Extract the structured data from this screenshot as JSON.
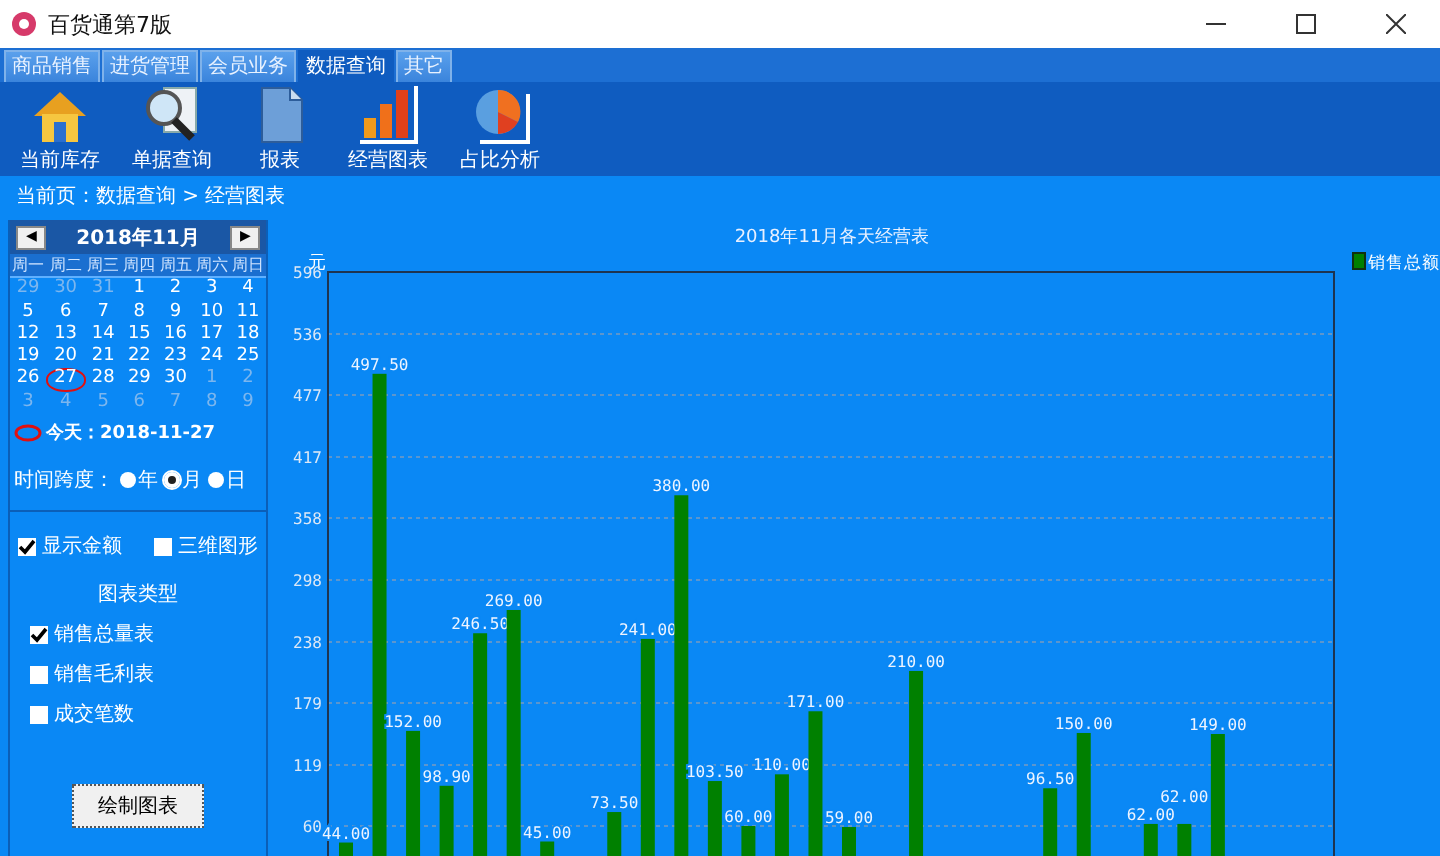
{
  "window": {
    "title": "百货通第7版"
  },
  "tabs": [
    {
      "label": "商品销售",
      "selected": false
    },
    {
      "label": "进货管理",
      "selected": false
    },
    {
      "label": "会员业务",
      "selected": false
    },
    {
      "label": "数据查询",
      "selected": true
    },
    {
      "label": "其它",
      "selected": false
    }
  ],
  "toolbar": [
    {
      "kind": "house",
      "label": "当前库存"
    },
    {
      "kind": "search",
      "label": "单据查询"
    },
    {
      "kind": "document",
      "label": "报表"
    },
    {
      "kind": "bars",
      "label": "经营图表"
    },
    {
      "kind": "pie",
      "label": "占比分析"
    }
  ],
  "breadcrumb": "当前页：数据查询 > 经营图表",
  "calendar": {
    "prev": "◀",
    "title": "2018年11月",
    "next": "▶",
    "weekdays": [
      "周一",
      "周二",
      "周三",
      "周四",
      "周五",
      "周六",
      "周日"
    ],
    "days": [
      {
        "day": "29",
        "muted": true,
        "selected": false
      },
      {
        "day": "30",
        "muted": true,
        "selected": false
      },
      {
        "day": "31",
        "muted": true,
        "selected": false
      },
      {
        "day": "1",
        "muted": false,
        "selected": false
      },
      {
        "day": "2",
        "muted": false,
        "selected": false
      },
      {
        "day": "3",
        "muted": false,
        "selected": false
      },
      {
        "day": "4",
        "muted": false,
        "selected": false
      },
      {
        "day": "5",
        "muted": false,
        "selected": false
      },
      {
        "day": "6",
        "muted": false,
        "selected": false
      },
      {
        "day": "7",
        "muted": false,
        "selected": false
      },
      {
        "day": "8",
        "muted": false,
        "selected": false
      },
      {
        "day": "9",
        "muted": false,
        "selected": false
      },
      {
        "day": "10",
        "muted": false,
        "selected": false
      },
      {
        "day": "11",
        "muted": false,
        "selected": false
      },
      {
        "day": "12",
        "muted": false,
        "selected": false
      },
      {
        "day": "13",
        "muted": false,
        "selected": false
      },
      {
        "day": "14",
        "muted": false,
        "selected": false
      },
      {
        "day": "15",
        "muted": false,
        "selected": false
      },
      {
        "day": "16",
        "muted": false,
        "selected": false
      },
      {
        "day": "17",
        "muted": false,
        "selected": false
      },
      {
        "day": "18",
        "muted": false,
        "selected": false
      },
      {
        "day": "19",
        "muted": false,
        "selected": false
      },
      {
        "day": "20",
        "muted": false,
        "selected": false
      },
      {
        "day": "21",
        "muted": false,
        "selected": false
      },
      {
        "day": "22",
        "muted": false,
        "selected": false
      },
      {
        "day": "23",
        "muted": false,
        "selected": false
      },
      {
        "day": "24",
        "muted": false,
        "selected": false
      },
      {
        "day": "25",
        "muted": false,
        "selected": false
      },
      {
        "day": "26",
        "muted": false,
        "selected": false
      },
      {
        "day": "27",
        "muted": false,
        "selected": true
      },
      {
        "day": "28",
        "muted": false,
        "selected": false
      },
      {
        "day": "29",
        "muted": false,
        "selected": false
      },
      {
        "day": "30",
        "muted": false,
        "selected": false
      },
      {
        "day": "1",
        "muted": true,
        "selected": false
      },
      {
        "day": "2",
        "muted": true,
        "selected": false
      },
      {
        "day": "3",
        "muted": true,
        "selected": false
      },
      {
        "day": "4",
        "muted": true,
        "selected": false
      },
      {
        "day": "5",
        "muted": true,
        "selected": false
      },
      {
        "day": "6",
        "muted": true,
        "selected": false
      },
      {
        "day": "7",
        "muted": true,
        "selected": false
      },
      {
        "day": "8",
        "muted": true,
        "selected": false
      },
      {
        "day": "9",
        "muted": true,
        "selected": false
      }
    ],
    "today": "今天：2018-11-27"
  },
  "span": {
    "label": "时间跨度：",
    "options": [
      {
        "label": "年",
        "selected": false
      },
      {
        "label": "月",
        "selected": true
      },
      {
        "label": "日",
        "selected": false
      }
    ]
  },
  "options": [
    {
      "label": "显示金额",
      "checked": true
    },
    {
      "label": "三维图形",
      "checked": false
    }
  ],
  "chart_types": {
    "title": "图表类型",
    "items": [
      {
        "label": "销售总量表",
        "checked": true
      },
      {
        "label": "销售毛利表",
        "checked": false
      },
      {
        "label": "成交笔数",
        "checked": false
      }
    ]
  },
  "draw_button": "绘制图表",
  "chart": {
    "chart_data": {
      "type": "bar",
      "title": "2018年11月各天经营表",
      "ylabel": "元",
      "ylim": [
        31,
        596
      ],
      "yticks": [
        60,
        119,
        179,
        238,
        298,
        358,
        417,
        477,
        536,
        596
      ],
      "grid": true,
      "value_labels": [
        "44.00",
        "497.50",
        "152.00",
        "98.90",
        "246.50",
        "269.00",
        "45.00",
        null,
        "73.50",
        "241.00",
        "380.00",
        "103.50",
        "60.00",
        "110.00",
        "171.00",
        "59.00",
        null,
        "210.00",
        null,
        null,
        null,
        "96.50",
        "150.00",
        null,
        "62.00",
        "62.00",
        "149.00",
        null,
        null,
        null
      ],
      "series": [
        {
          "name": "销售总额",
          "color": "#008000",
          "values": [
            44,
            497.5,
            152,
            98.9,
            246.5,
            269,
            45,
            null,
            73.5,
            241,
            380,
            103.5,
            60,
            110,
            171,
            59,
            null,
            210,
            null,
            null,
            null,
            96.5,
            150,
            null,
            62,
            62,
            149,
            null,
            null,
            null
          ]
        }
      ]
    }
  }
}
